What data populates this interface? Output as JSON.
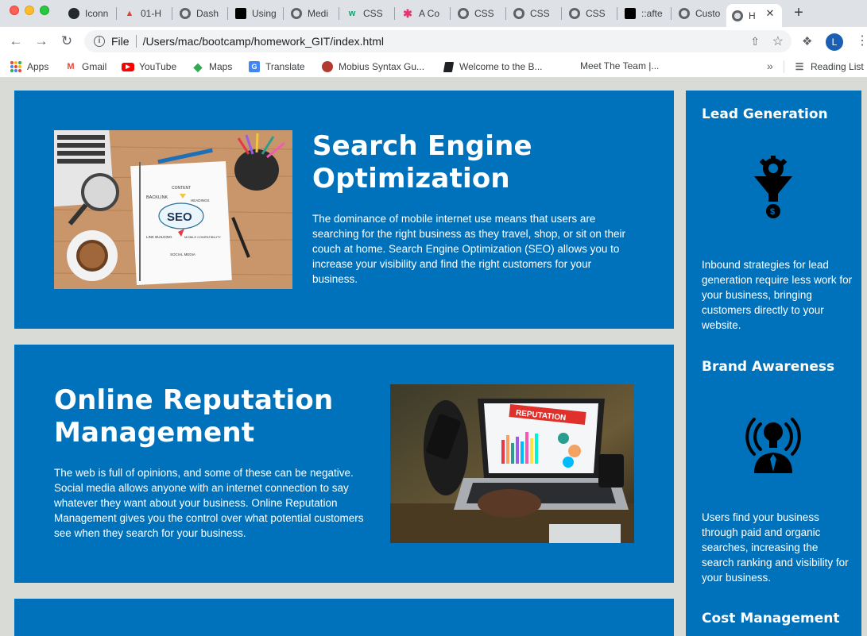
{
  "browser": {
    "tabs": [
      {
        "label": "Iconn",
        "icon": "github-icon"
      },
      {
        "label": "01-H",
        "icon": "gitlab-icon"
      },
      {
        "label": "Dash",
        "icon": "globe-icon"
      },
      {
        "label": "Using",
        "icon": "bootcamp-icon"
      },
      {
        "label": "Medi",
        "icon": "globe-icon"
      },
      {
        "label": "CSS",
        "icon": "w3schools-icon"
      },
      {
        "label": "A Co",
        "icon": "asterisk-icon"
      },
      {
        "label": "CSS",
        "icon": "globe-icon"
      },
      {
        "label": "CSS",
        "icon": "globe-icon"
      },
      {
        "label": "CSS",
        "icon": "globe-icon"
      },
      {
        "label": "::afte",
        "icon": "bootcamp-icon"
      },
      {
        "label": "Custo",
        "icon": "globe-icon"
      },
      {
        "label": "H",
        "icon": "globe-icon",
        "active": true
      }
    ],
    "url_scheme": "File",
    "url": "/Users/mac/bootcamp/homework_GIT/index.html",
    "profile_initial": "L",
    "bookmarks": [
      {
        "label": "Apps",
        "icon": "apps-grid-icon"
      },
      {
        "label": "Gmail",
        "icon": "gmail-icon"
      },
      {
        "label": "YouTube",
        "icon": "youtube-icon"
      },
      {
        "label": "Maps",
        "icon": "maps-icon"
      },
      {
        "label": "Translate",
        "icon": "translate-icon"
      },
      {
        "label": "Mobius Syntax Gu...",
        "icon": "mobius-icon"
      },
      {
        "label": "Welcome to the B...",
        "icon": "book-icon"
      },
      {
        "label": "Meet The Team |...",
        "icon": ""
      }
    ],
    "reading_list": "Reading List"
  },
  "articles": [
    {
      "title": "Search Engine Optimization",
      "text": "The dominance of mobile internet use means that users are searching for the right business as they travel, shop, or sit on their couch at home. Search Engine Optimization (SEO) allows you to increase your visibility and find the right customers for your business."
    },
    {
      "title": "Online Reputation Management",
      "text": "The web is full of opinions, and some of these can be negative. Social media allows anyone with an internet connection to say whatever they want about your business. Online Reputation Management gives you the control over what potential customers see when they search for your business."
    }
  ],
  "seo_image_labels": {
    "content": "CONTENT",
    "backlink": "BACKLINK",
    "headings": "HEADINGS",
    "seo": "SEO",
    "link_building": "LINK BUILDING",
    "mobile": "MOBILE COMPATIBILITY",
    "social": "SOCIAL MEDIA"
  },
  "reputation_image_label": "REPUTATION",
  "sidebar": [
    {
      "title": "Lead Generation",
      "icon": "lead-generation-funnel-icon",
      "text": "Inbound strategies for lead generation require less work for your business, bringing customers directly to your website."
    },
    {
      "title": "Brand Awareness",
      "icon": "brand-awareness-broadcast-icon",
      "text": "Users find your business through paid and organic searches, increasing the search ranking and visibility for your business."
    },
    {
      "title": "Cost Management",
      "icon": "",
      "text": ""
    }
  ],
  "colors": {
    "page_bg": "#d9dcd6",
    "panel_blue": "#0072bb"
  }
}
